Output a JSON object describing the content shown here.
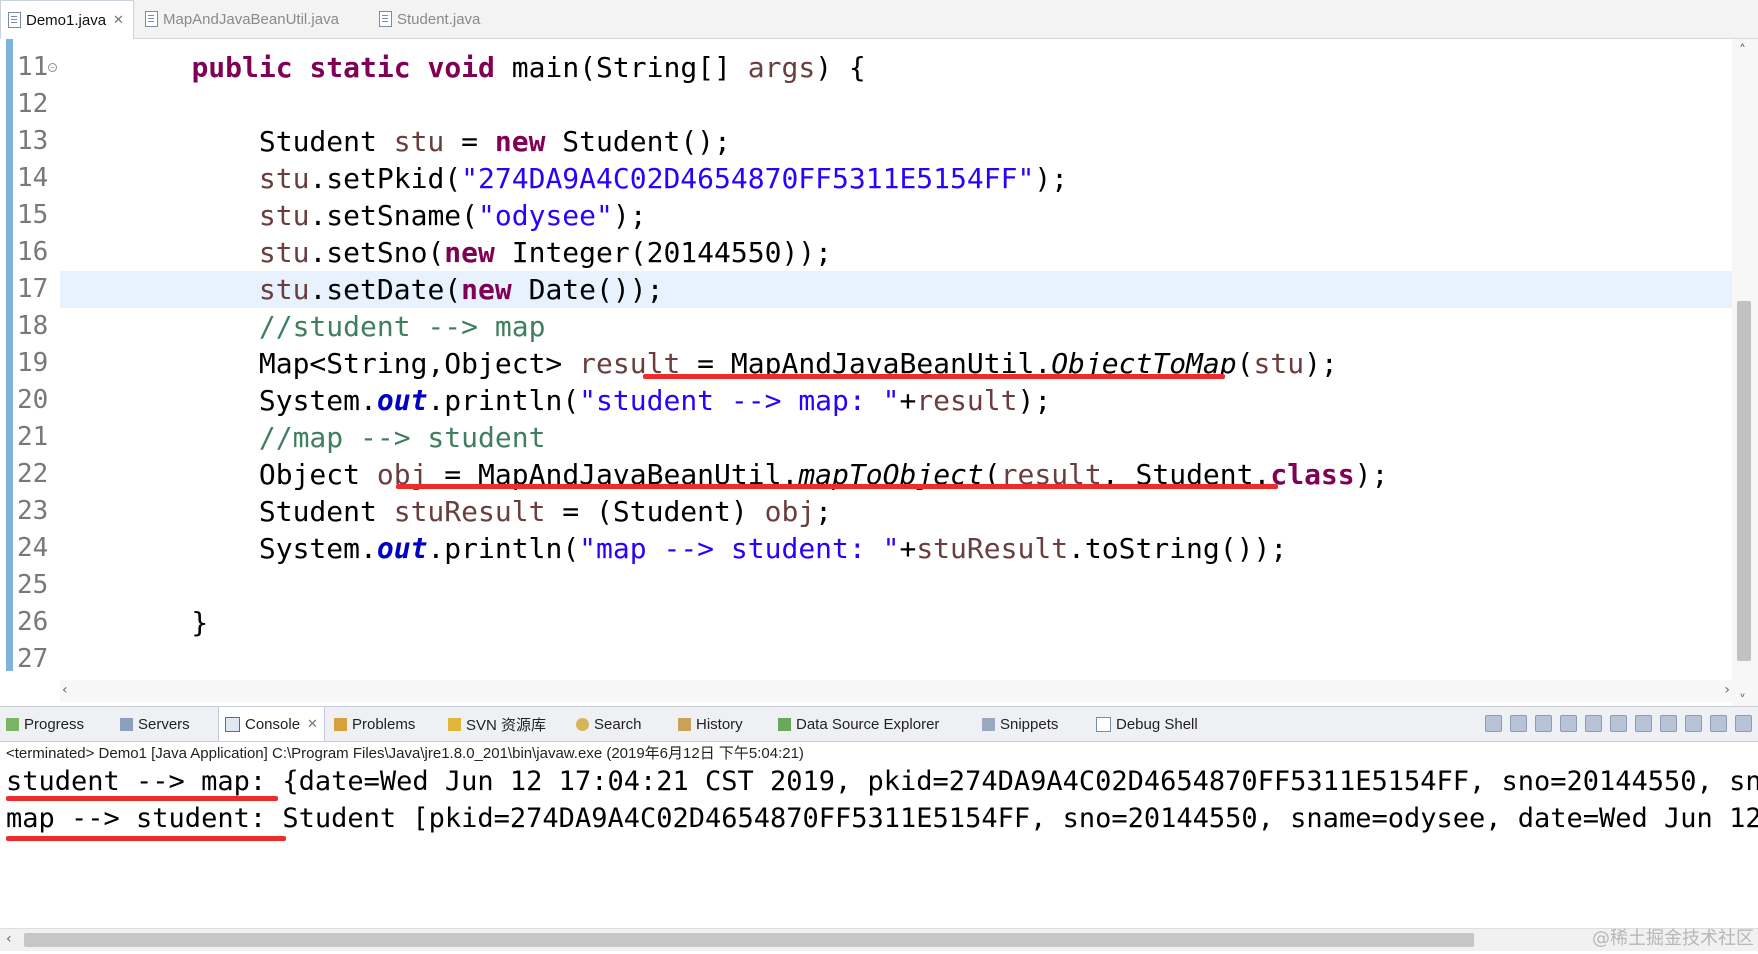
{
  "editor_tabs": [
    {
      "label": "Demo1.java",
      "active": true
    },
    {
      "label": "MapAndJavaBeanUtil.java",
      "active": false
    },
    {
      "label": "Student.java",
      "active": false
    }
  ],
  "code_lines": [
    {
      "num": "11",
      "tokens": [
        {
          "t": "    "
        },
        {
          "t": "public",
          "c": "kw"
        },
        {
          "t": " "
        },
        {
          "t": "static",
          "c": "kw"
        },
        {
          "t": " "
        },
        {
          "t": "void",
          "c": "kw"
        },
        {
          "t": " main(String[] "
        },
        {
          "t": "args",
          "c": "vr"
        },
        {
          "t": ") {"
        }
      ],
      "fold": true
    },
    {
      "num": "12",
      "tokens": []
    },
    {
      "num": "13",
      "tokens": [
        {
          "t": "        Student "
        },
        {
          "t": "stu",
          "c": "vr"
        },
        {
          "t": " = "
        },
        {
          "t": "new",
          "c": "kw"
        },
        {
          "t": " Student();"
        }
      ]
    },
    {
      "num": "14",
      "tokens": [
        {
          "t": "        "
        },
        {
          "t": "stu",
          "c": "vr"
        },
        {
          "t": ".setPkid("
        },
        {
          "t": "\"274DA9A4C02D4654870FF5311E5154FF\"",
          "c": "str"
        },
        {
          "t": ");"
        }
      ]
    },
    {
      "num": "15",
      "tokens": [
        {
          "t": "        "
        },
        {
          "t": "stu",
          "c": "vr"
        },
        {
          "t": ".setSname("
        },
        {
          "t": "\"odysee\"",
          "c": "str"
        },
        {
          "t": ");"
        }
      ]
    },
    {
      "num": "16",
      "tokens": [
        {
          "t": "        "
        },
        {
          "t": "stu",
          "c": "vr"
        },
        {
          "t": ".setSno("
        },
        {
          "t": "new",
          "c": "kw"
        },
        {
          "t": " Integer(20144550));"
        }
      ]
    },
    {
      "num": "17",
      "tokens": [
        {
          "t": "        "
        },
        {
          "t": "stu",
          "c": "vr"
        },
        {
          "t": ".setDate("
        },
        {
          "t": "new",
          "c": "kw"
        },
        {
          "t": " Date());"
        }
      ],
      "highlight": true
    },
    {
      "num": "18",
      "tokens": [
        {
          "t": "        "
        },
        {
          "t": "//student --> map",
          "c": "cm"
        }
      ]
    },
    {
      "num": "19",
      "tokens": [
        {
          "t": "        Map<String,Object> "
        },
        {
          "t": "result",
          "c": "vr"
        },
        {
          "t": " = MapAndJavaBeanUtil."
        },
        {
          "t": "ObjectToMap",
          "c": "it"
        },
        {
          "t": "("
        },
        {
          "t": "stu",
          "c": "vr"
        },
        {
          "t": ");"
        }
      ]
    },
    {
      "num": "20",
      "tokens": [
        {
          "t": "        System."
        },
        {
          "t": "out",
          "c": "fd"
        },
        {
          "t": ".println("
        },
        {
          "t": "\"student --> map: \"",
          "c": "str"
        },
        {
          "t": "+"
        },
        {
          "t": "result",
          "c": "vr"
        },
        {
          "t": ");"
        }
      ]
    },
    {
      "num": "21",
      "tokens": [
        {
          "t": "        "
        },
        {
          "t": "//map --> student",
          "c": "cm"
        }
      ]
    },
    {
      "num": "22",
      "tokens": [
        {
          "t": "        Object "
        },
        {
          "t": "obj",
          "c": "vr"
        },
        {
          "t": " = MapAndJavaBeanUtil."
        },
        {
          "t": "mapToObject",
          "c": "it"
        },
        {
          "t": "("
        },
        {
          "t": "result",
          "c": "vr"
        },
        {
          "t": ", Student."
        },
        {
          "t": "class",
          "c": "kw"
        },
        {
          "t": ");"
        }
      ]
    },
    {
      "num": "23",
      "tokens": [
        {
          "t": "        Student "
        },
        {
          "t": "stuResult",
          "c": "vr"
        },
        {
          "t": " = (Student) "
        },
        {
          "t": "obj",
          "c": "vr"
        },
        {
          "t": ";"
        }
      ]
    },
    {
      "num": "24",
      "tokens": [
        {
          "t": "        System."
        },
        {
          "t": "out",
          "c": "fd"
        },
        {
          "t": ".println("
        },
        {
          "t": "\"map --> student: \"",
          "c": "str"
        },
        {
          "t": "+"
        },
        {
          "t": "stuResult",
          "c": "vr"
        },
        {
          "t": ".toString());"
        }
      ]
    },
    {
      "num": "25",
      "tokens": []
    },
    {
      "num": "26",
      "tokens": [
        {
          "t": "    }"
        }
      ]
    },
    {
      "num": "27",
      "tokens": []
    }
  ],
  "view_tabs": [
    {
      "label": "Progress",
      "active": false
    },
    {
      "label": "Servers",
      "active": false
    },
    {
      "label": "Console",
      "active": true
    },
    {
      "label": "Problems",
      "active": false
    },
    {
      "label": "SVN 资源库",
      "active": false
    },
    {
      "label": "Search",
      "active": false
    },
    {
      "label": "History",
      "active": false
    },
    {
      "label": "Data Source Explorer",
      "active": false
    },
    {
      "label": "Snippets",
      "active": false
    },
    {
      "label": "Debug Shell",
      "active": false
    }
  ],
  "console": {
    "status": "<terminated> Demo1 [Java Application] C:\\Program Files\\Java\\jre1.8.0_201\\bin\\javaw.exe (2019年6月12日 下午5:04:21)",
    "lines": [
      "student --> map: {date=Wed Jun 12 17:04:21 CST 2019, pkid=274DA9A4C02D4654870FF5311E5154FF, sno=20144550, sna",
      "map --> student: Student [pkid=274DA9A4C02D4654870FF5311E5154FF, sno=20144550, sname=odysee, date=Wed Jun 12"
    ]
  },
  "watermark": "@稀土掘金技术社区",
  "colors": {
    "keyword": "#7f0055",
    "string": "#2a00ff",
    "comment": "#3f7f5f",
    "field": "#0000c0",
    "annotation": "#ee2c2c"
  }
}
